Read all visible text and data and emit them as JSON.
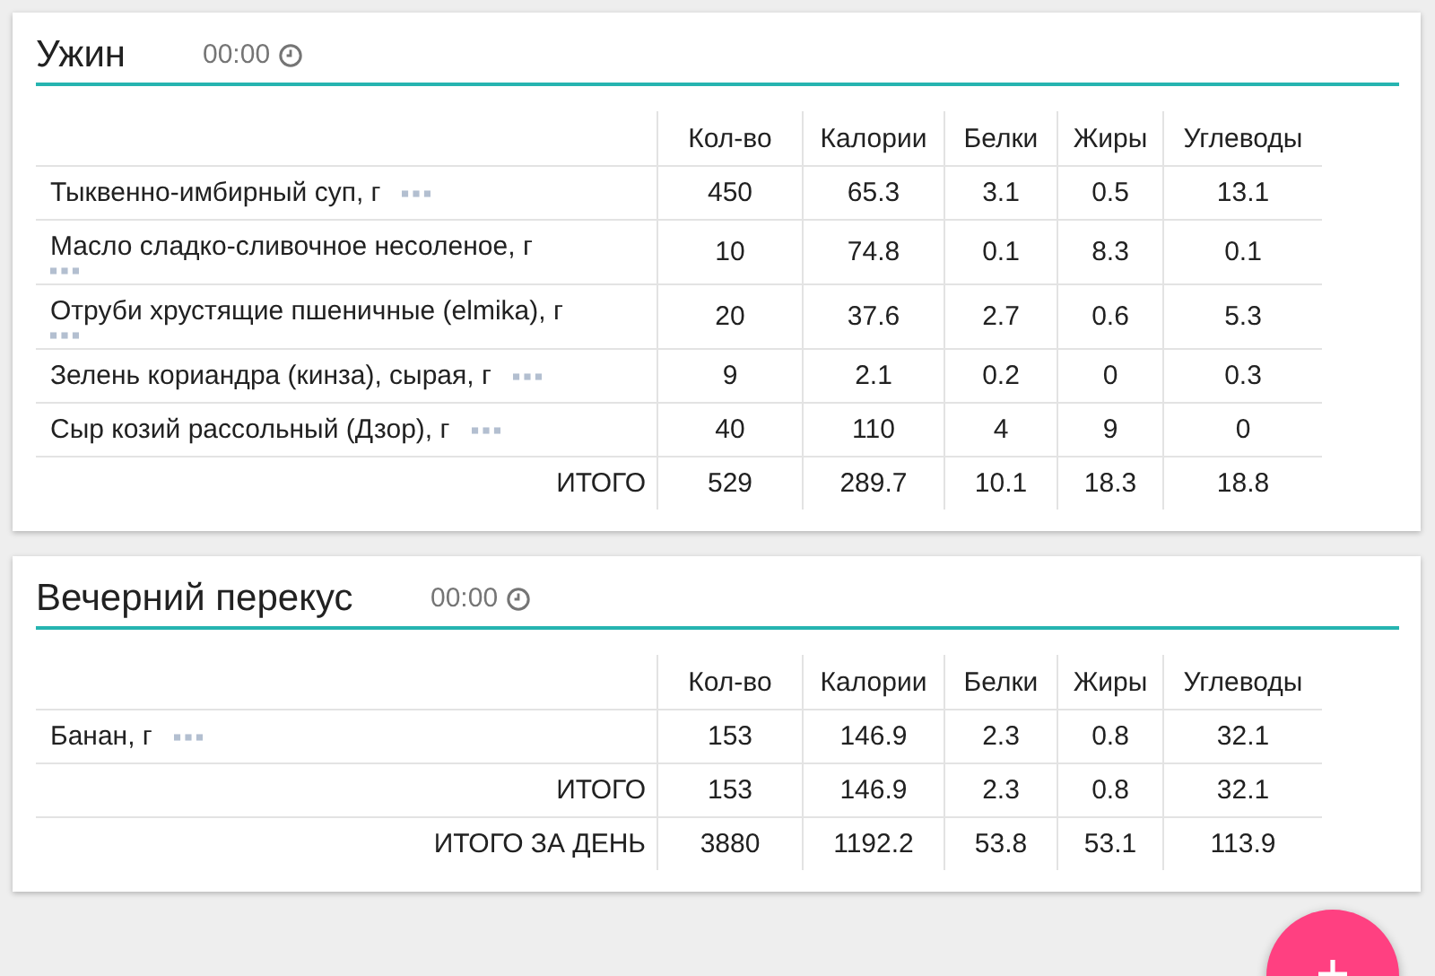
{
  "meals": [
    {
      "title": "Ужин",
      "time": "00:00",
      "columns": [
        "Кол-во",
        "Калории",
        "Белки",
        "Жиры",
        "Углеводы"
      ],
      "rows": [
        {
          "name": "Тыквенно-имбирный суп, г",
          "values": [
            "450",
            "65.3",
            "3.1",
            "0.5",
            "13.1"
          ]
        },
        {
          "name": "Масло сладко-сливочное несоленое, г",
          "values": [
            "10",
            "74.8",
            "0.1",
            "8.3",
            "0.1"
          ]
        },
        {
          "name": "Отруби хрустящие пшеничные (elmika), г",
          "values": [
            "20",
            "37.6",
            "2.7",
            "0.6",
            "5.3"
          ]
        },
        {
          "name": "Зелень кориандра (кинза), сырая, г",
          "values": [
            "9",
            "2.1",
            "0.2",
            "0",
            "0.3"
          ]
        },
        {
          "name": "Сыр козий рассольный (Дзор), г",
          "values": [
            "40",
            "110",
            "4",
            "9",
            "0"
          ]
        }
      ],
      "totals": [
        {
          "label": "ИТОГО",
          "values": [
            "529",
            "289.7",
            "10.1",
            "18.3",
            "18.8"
          ]
        }
      ]
    },
    {
      "title": "Вечерний перекус",
      "time": "00:00",
      "columns": [
        "Кол-во",
        "Калории",
        "Белки",
        "Жиры",
        "Углеводы"
      ],
      "rows": [
        {
          "name": "Банан, г",
          "values": [
            "153",
            "146.9",
            "2.3",
            "0.8",
            "32.1"
          ]
        }
      ],
      "totals": [
        {
          "label": "ИТОГО",
          "values": [
            "153",
            "146.9",
            "2.3",
            "0.8",
            "32.1"
          ]
        },
        {
          "label": "ИТОГО ЗА ДЕНЬ",
          "values": [
            "3880",
            "1192.2",
            "53.8",
            "53.1",
            "113.9"
          ]
        }
      ]
    }
  ]
}
